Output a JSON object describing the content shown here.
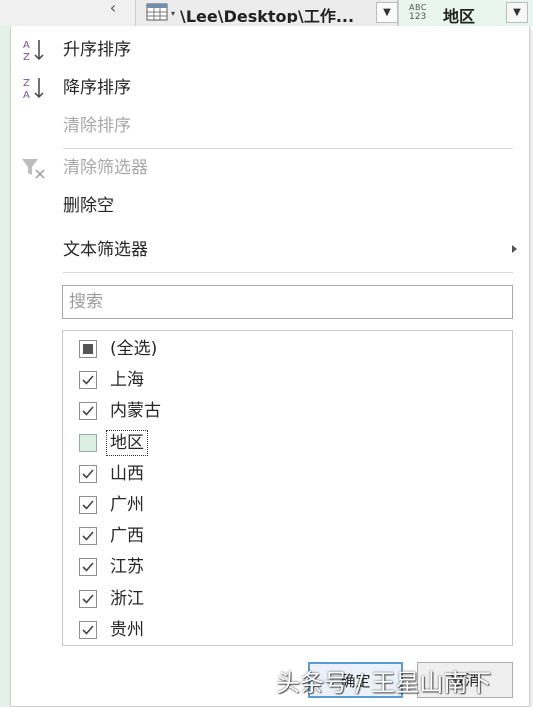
{
  "header": {
    "column1_title": "\\Lee\\Desktop\\工作...",
    "column2_type_top": "ABC",
    "column2_type_bottom": "123",
    "column2_title": "地区"
  },
  "menu": {
    "sort_ascending": "升序排序",
    "sort_descending": "降序排序",
    "clear_sort": "清除排序",
    "clear_filter": "清除筛选器",
    "remove_empty": "删除空",
    "text_filters": "文本筛选器"
  },
  "search": {
    "placeholder": "搜索",
    "value": ""
  },
  "list": [
    {
      "label": "(全选)",
      "state": "partial"
    },
    {
      "label": "上海",
      "state": "checked"
    },
    {
      "label": "内蒙古",
      "state": "checked"
    },
    {
      "label": "地区",
      "state": "unchecked"
    },
    {
      "label": "山西",
      "state": "checked"
    },
    {
      "label": "广州",
      "state": "checked"
    },
    {
      "label": "广西",
      "state": "checked"
    },
    {
      "label": "江苏",
      "state": "checked"
    },
    {
      "label": "浙江",
      "state": "checked"
    },
    {
      "label": "贵州",
      "state": "checked"
    }
  ],
  "buttons": {
    "ok": "确定",
    "cancel": "取消"
  },
  "watermark": "头条号 / 王星山南下",
  "colors": {
    "accent": "#5b9bd5",
    "selected_column": "#e9f5ef",
    "sort_icon": "#7a4fa0"
  }
}
